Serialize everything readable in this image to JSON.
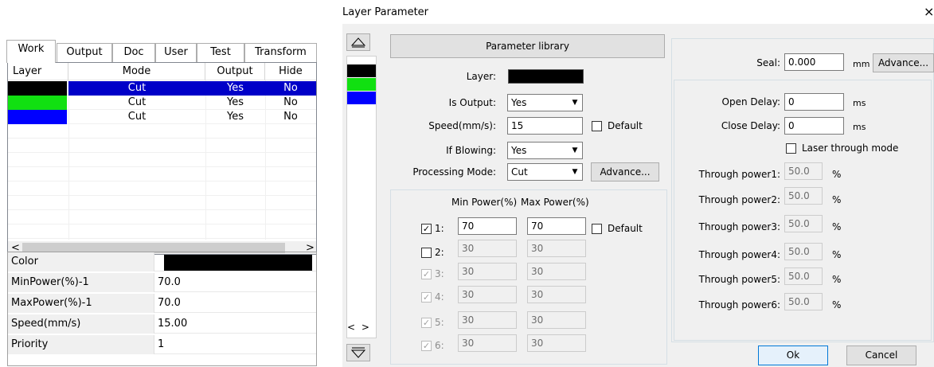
{
  "left_panel": {
    "tabs": [
      "Work",
      "Output",
      "Doc",
      "User",
      "Test",
      "Transform"
    ],
    "table": {
      "headers": [
        "Layer",
        "Mode",
        "Output",
        "Hide"
      ],
      "rows": [
        {
          "color": "#000000",
          "mode": "Cut",
          "output": "Yes",
          "hide": "No",
          "selected": true
        },
        {
          "color": "#11e011",
          "mode": "Cut",
          "output": "Yes",
          "hide": "No",
          "selected": false
        },
        {
          "color": "#0000ff",
          "mode": "Cut",
          "output": "Yes",
          "hide": "No",
          "selected": false
        }
      ],
      "scroll_left": "<",
      "scroll_right": ">"
    },
    "properties": [
      {
        "label": "Color",
        "value": ""
      },
      {
        "label": "MinPower(%)-1",
        "value": "70.0"
      },
      {
        "label": "MaxPower(%)-1",
        "value": "70.0"
      },
      {
        "label": "Speed(mm/s)",
        "value": "15.00"
      },
      {
        "label": "Priority",
        "value": "1"
      }
    ],
    "color_value": "#000000"
  },
  "dialog": {
    "title": "Layer Parameter",
    "close": "×",
    "layer_strip_colors": [
      "#000000",
      "#11e011",
      "#0000ff"
    ],
    "nav_lr": "< >",
    "param_library": "Parameter library",
    "layer_label": "Layer:",
    "layer_color": "#000000",
    "is_output_label": "Is Output:",
    "is_output_value": "Yes",
    "speed_label": "Speed(mm/s):",
    "speed_value": "15",
    "default_label": "Default",
    "if_blowing_label": "If Blowing:",
    "if_blowing_value": "Yes",
    "processing_mode_label": "Processing Mode:",
    "processing_mode_value": "Cut",
    "advance_label": "Advance...",
    "min_power_header": "Min Power(%)",
    "max_power_header": "Max Power(%)",
    "power_default_label": "Default",
    "power_rows": [
      {
        "label": "1:",
        "checked": true,
        "enabled": true,
        "min": "70",
        "max": "70"
      },
      {
        "label": "2:",
        "checked": false,
        "enabled": true,
        "min": "30",
        "max": "30"
      },
      {
        "label": "3:",
        "checked": true,
        "enabled": false,
        "min": "30",
        "max": "30"
      },
      {
        "label": "4:",
        "checked": true,
        "enabled": false,
        "min": "30",
        "max": "30"
      },
      {
        "label": "5:",
        "checked": true,
        "enabled": false,
        "min": "30",
        "max": "30"
      },
      {
        "label": "6:",
        "checked": true,
        "enabled": false,
        "min": "30",
        "max": "30"
      }
    ],
    "seal_label": "Seal:",
    "seal_value": "0.000",
    "seal_unit": "mm",
    "seal_advance": "Advance...",
    "open_delay_label": "Open Delay:",
    "open_delay_value": "0",
    "close_delay_label": "Close Delay:",
    "close_delay_value": "0",
    "delay_unit": "ms",
    "laser_through_label": "Laser through mode",
    "through_powers": [
      {
        "label": "Through power1:",
        "value": "50.0"
      },
      {
        "label": "Through power2:",
        "value": "50.0"
      },
      {
        "label": "Through power3:",
        "value": "50.0"
      },
      {
        "label": "Through power4:",
        "value": "50.0"
      },
      {
        "label": "Through power5:",
        "value": "50.0"
      },
      {
        "label": "Through power6:",
        "value": "50.0"
      }
    ],
    "percent": "%",
    "ok_label": "Ok",
    "cancel_label": "Cancel"
  }
}
